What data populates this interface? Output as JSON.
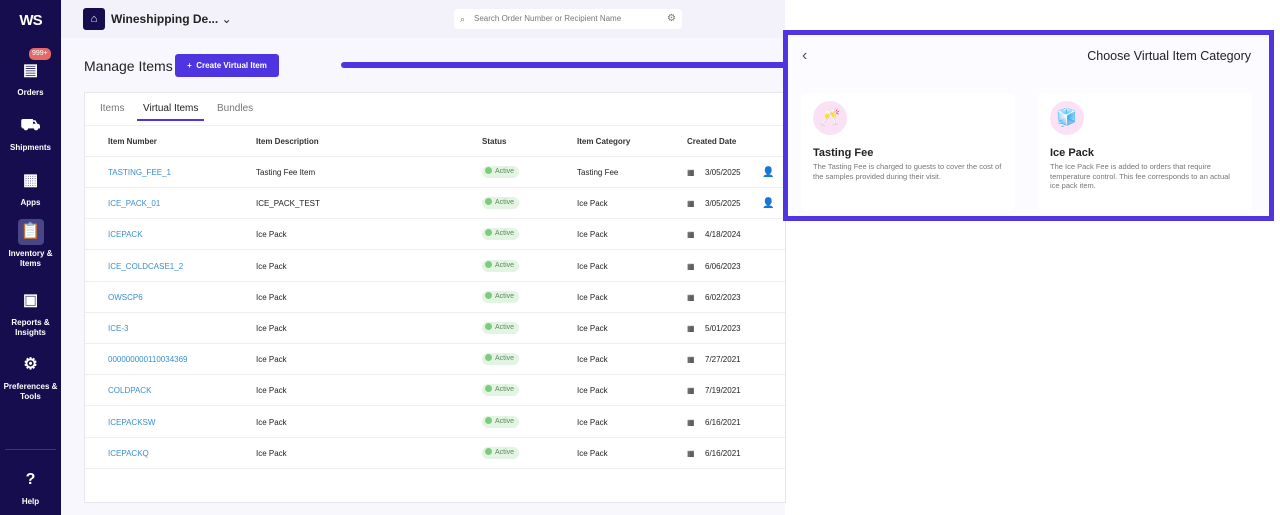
{
  "sidebar": {
    "logo": "WS",
    "orders_badge": "999+",
    "items": [
      {
        "label": "Orders",
        "icon": "archive-icon"
      },
      {
        "label": "Shipments",
        "icon": "truck-icon"
      },
      {
        "label": "Apps",
        "icon": "apps-icon"
      },
      {
        "label": "Inventory & Items",
        "icon": "clipboard-icon"
      },
      {
        "label": "Reports & Insights",
        "icon": "chart-icon"
      },
      {
        "label": "Preferences & Tools",
        "icon": "gear-icon"
      }
    ],
    "help": "Help"
  },
  "header": {
    "org": "Wineshipping De...",
    "search_placeholder": "Search Order Number or Recipient Name"
  },
  "page": {
    "title": "Manage Items",
    "create_button": "Create Virtual Item"
  },
  "tabs": [
    "Items",
    "Virtual Items",
    "Bundles"
  ],
  "table": {
    "columns": [
      "Item Number",
      "Item Description",
      "Status",
      "Item Category",
      "Created Date"
    ],
    "rows": [
      {
        "number": "TASTING_FEE_1",
        "desc": "Tasting Fee Item",
        "status": "Active",
        "category": "Tasting Fee",
        "date": "3/05/2025",
        "user": true
      },
      {
        "number": "ICE_PACK_01",
        "desc": "ICE_PACK_TEST",
        "status": "Active",
        "category": "Ice Pack",
        "date": "3/05/2025",
        "user": true
      },
      {
        "number": "ICEPACK",
        "desc": "Ice Pack",
        "status": "Active",
        "category": "Ice Pack",
        "date": "4/18/2024"
      },
      {
        "number": "ICE_COLDCASE1_2",
        "desc": "Ice Pack",
        "status": "Active",
        "category": "Ice Pack",
        "date": "6/06/2023"
      },
      {
        "number": "OWSCP6",
        "desc": "Ice Pack",
        "status": "Active",
        "category": "Ice Pack",
        "date": "6/02/2023"
      },
      {
        "number": "ICE-3",
        "desc": "Ice Pack",
        "status": "Active",
        "category": "Ice Pack",
        "date": "5/01/2023"
      },
      {
        "number": "000000000110034369",
        "desc": "Ice Pack",
        "status": "Active",
        "category": "Ice Pack",
        "date": "7/27/2021"
      },
      {
        "number": "COLDPACK",
        "desc": "Ice Pack",
        "status": "Active",
        "category": "Ice Pack",
        "date": "7/19/2021"
      },
      {
        "number": "ICEPACKSW",
        "desc": "Ice Pack",
        "status": "Active",
        "category": "Ice Pack",
        "date": "6/16/2021"
      },
      {
        "number": "ICEPACKQ",
        "desc": "Ice Pack",
        "status": "Active",
        "category": "Ice Pack",
        "date": "6/16/2021"
      }
    ]
  },
  "panel": {
    "title": "Choose Virtual Item Category",
    "categories": [
      {
        "name": "Tasting Fee",
        "emoji": "🥂",
        "description": "The Tasting Fee is charged to guests to cover the cost of the samples provided during their visit."
      },
      {
        "name": "Ice Pack",
        "emoji": "🧊",
        "description": "The Ice Pack Fee is added to orders that require temperature control. This fee corresponds to an actual ice pack item."
      }
    ]
  }
}
